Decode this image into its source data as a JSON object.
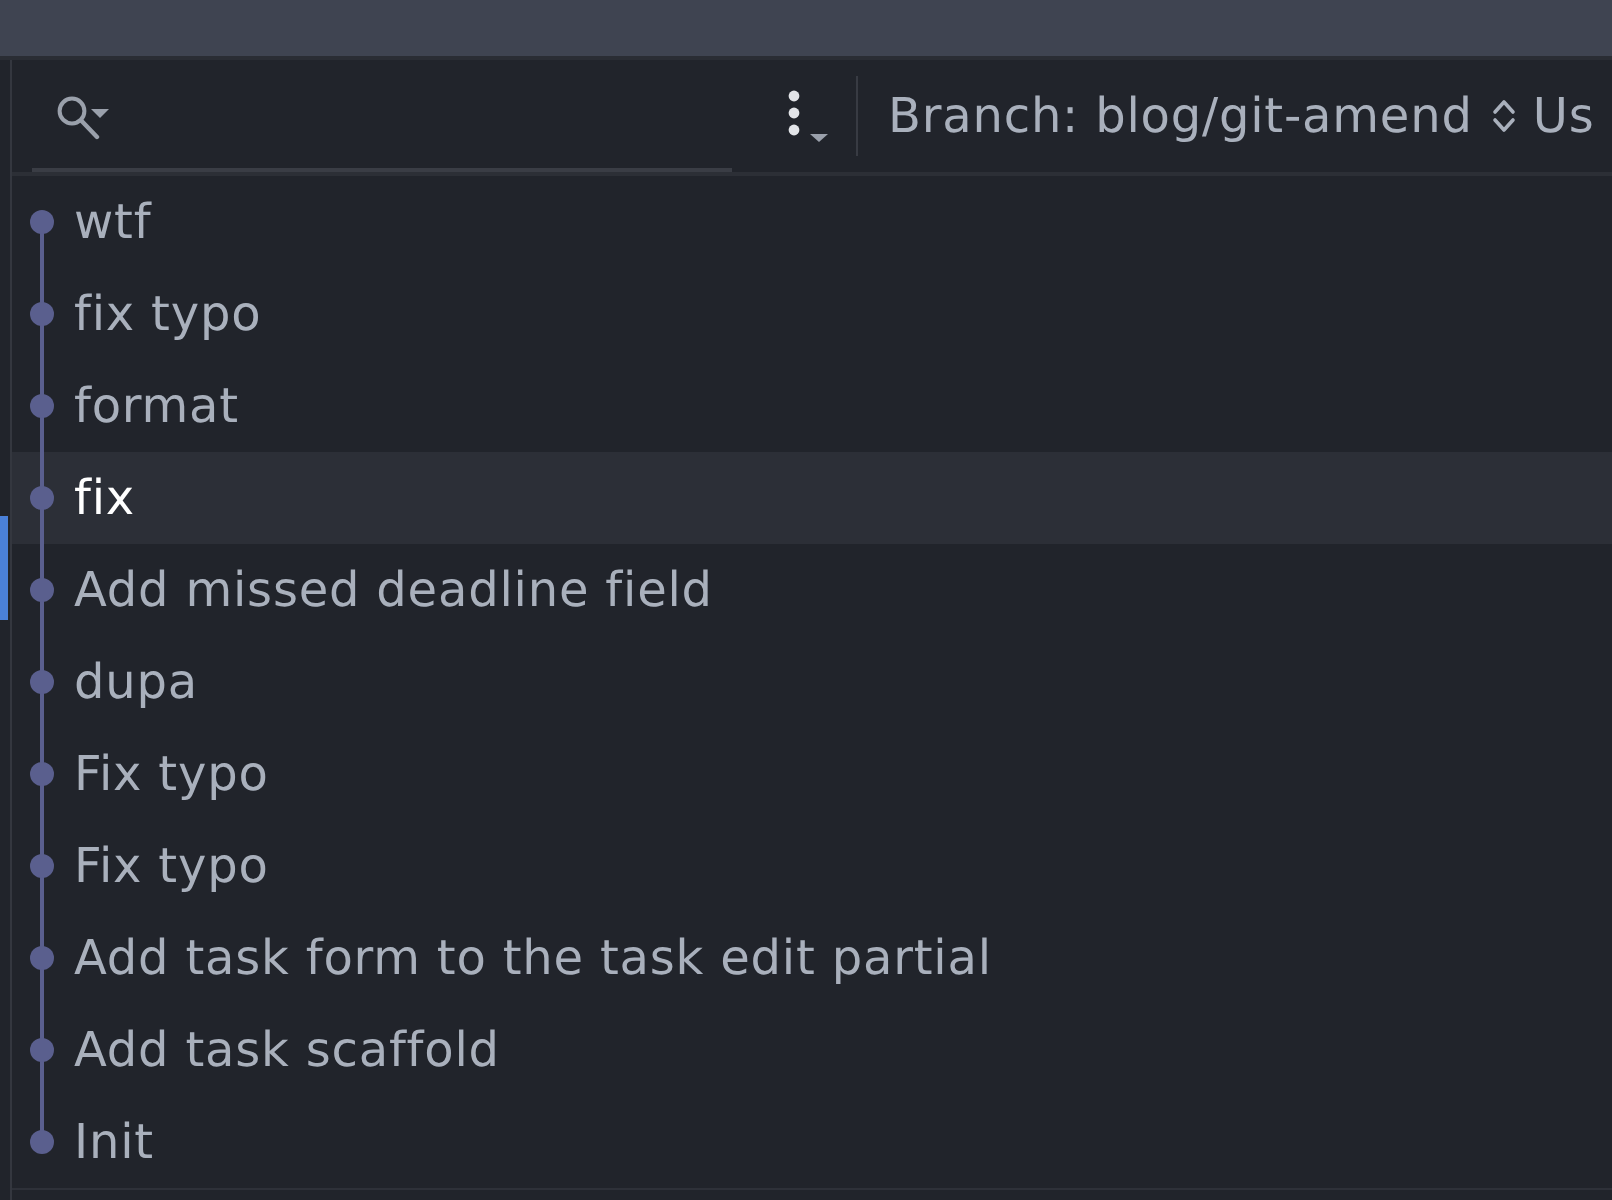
{
  "toolbar": {
    "branch_filter": {
      "label": "Branch: blog/git-amend"
    },
    "filter_2": {
      "label": "Us"
    }
  },
  "commits": [
    {
      "message": "wtf",
      "selected": false
    },
    {
      "message": "fix typo",
      "selected": false
    },
    {
      "message": "format",
      "selected": false
    },
    {
      "message": "fix",
      "selected": true
    },
    {
      "message": "Add missed deadline field",
      "selected": false
    },
    {
      "message": "dupa",
      "selected": false
    },
    {
      "message": "Fix typo",
      "selected": false
    },
    {
      "message": "Fix typo",
      "selected": false
    },
    {
      "message": "Add task form to the task edit partial",
      "selected": false
    },
    {
      "message": "Add task scaffold",
      "selected": false
    },
    {
      "message": "Init",
      "selected": false
    }
  ]
}
